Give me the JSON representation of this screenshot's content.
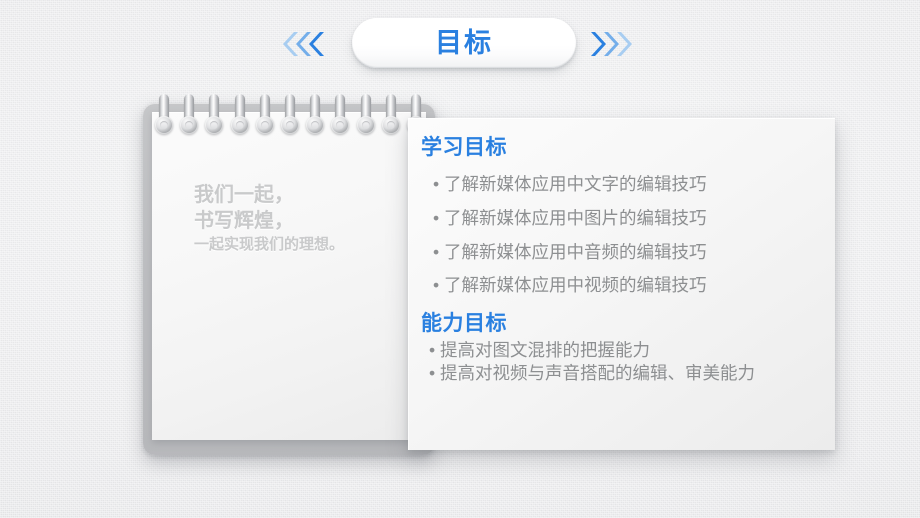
{
  "header": {
    "title": "目标",
    "left_arrows_icon": "chevrons-left-icon",
    "right_arrows_icon": "chevrons-right-icon",
    "accent_color": "#2a80e0"
  },
  "notepad": {
    "icon": "spiral-notepad",
    "ring_count": 11,
    "lines": [
      {
        "text": "我们一起，",
        "size": "large"
      },
      {
        "text": "书写辉煌，",
        "size": "large"
      },
      {
        "text": "一起实现我们的理想。",
        "size": "small"
      }
    ],
    "text_color": "#c9cacb"
  },
  "panel": {
    "sections": [
      {
        "title": "学习目标",
        "spacing": "spaced",
        "bullet": "•",
        "items": [
          "了解新媒体应用中文字的编辑技巧",
          "了解新媒体应用中图片的编辑技巧",
          "了解新媒体应用中音频的编辑技巧",
          "了解新媒体应用中视频的编辑技巧"
        ]
      },
      {
        "title": "能力目标",
        "spacing": "tight",
        "bullet": "•",
        "items": [
          "提高对图文混排的把握能力",
          "提高对视频与声音搭配的编辑、审美能力"
        ]
      }
    ],
    "title_color": "#2a80e0",
    "body_color": "#8d8f91"
  }
}
